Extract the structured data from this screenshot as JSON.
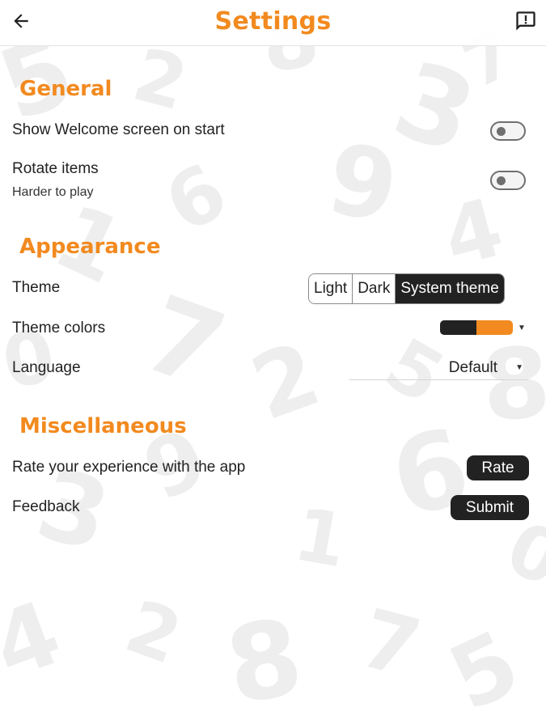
{
  "appbar": {
    "title": "Settings",
    "back_icon": "arrow-left-icon",
    "feedback_icon": "report-message-icon"
  },
  "sections": {
    "general": {
      "title": "General",
      "welcome": {
        "label": "Show Welcome screen on start",
        "enabled": false
      },
      "rotate": {
        "label": "Rotate items",
        "sublabel": "Harder to play",
        "enabled": false
      }
    },
    "appearance": {
      "title": "Appearance",
      "theme": {
        "label": "Theme",
        "options": [
          "Light",
          "Dark",
          "System theme"
        ],
        "selected": "System theme"
      },
      "theme_colors": {
        "label": "Theme colors",
        "colors": [
          "#222222",
          "#f28a1f"
        ]
      },
      "language": {
        "label": "Language",
        "value": "Default"
      }
    },
    "misc": {
      "title": "Miscellaneous",
      "rate": {
        "label": "Rate your experience with the app",
        "button": "Rate"
      },
      "feedback": {
        "label": "Feedback",
        "button": "Submit"
      }
    }
  },
  "colors": {
    "accent": "#f28a1f",
    "dark": "#222222"
  }
}
